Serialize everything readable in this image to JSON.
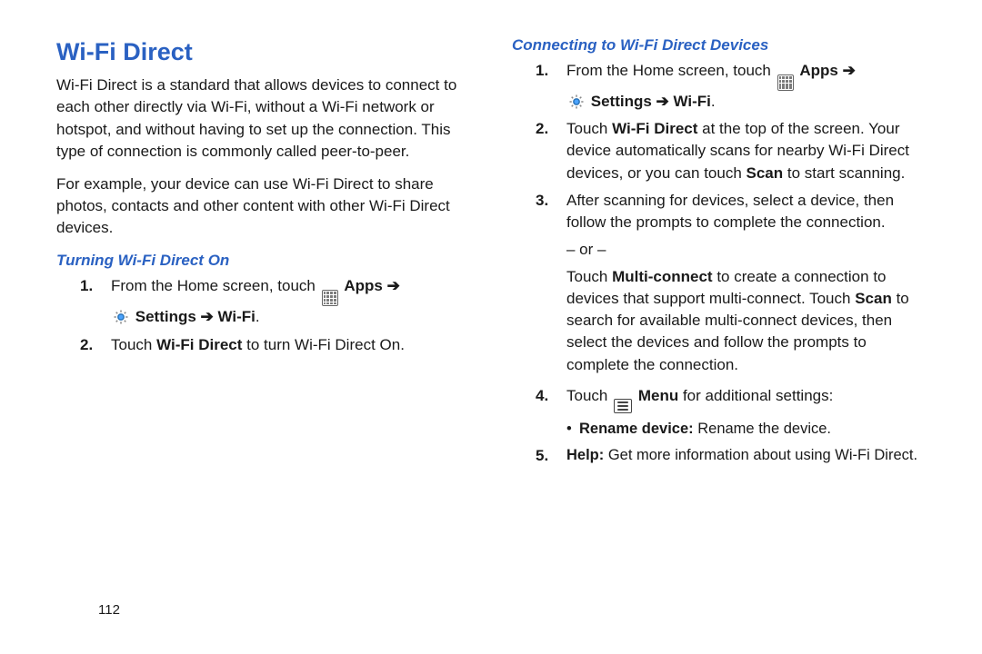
{
  "pageNumber": "112",
  "title": "Wi-Fi Direct",
  "intro1": "Wi-Fi Direct is a standard that allows devices to connect to each other directly via Wi-Fi, without a Wi-Fi network or hotspot, and without having to set up the connection. This type of connection is commonly called peer-to-peer.",
  "intro2": "For example, your device can use Wi-Fi Direct to share photos, contacts and other content with other Wi-Fi Direct devices.",
  "sub1": "Turning Wi-Fi Direct On",
  "left_step1_a": "From the Home screen, touch ",
  "apps_label": "Apps",
  "arrow": "➔",
  "settings_label": "Settings",
  "wifi_label": "Wi-Fi",
  "period": ".",
  "left_step2_a": "Touch ",
  "left_step2_b": "Wi-Fi Direct",
  "left_step2_c": " to turn Wi-Fi Direct On.",
  "sub2": "Connecting to Wi-Fi Direct Devices",
  "r_step1_a": "From the Home screen, touch ",
  "r_step2_a": "Touch ",
  "r_step2_b": "Wi-Fi Direct",
  "r_step2_c": " at the top of the screen. Your device automatically scans for nearby Wi-Fi Direct devices, or you can touch ",
  "r_step2_d": "Scan",
  "r_step2_e": " to start scanning.",
  "r_step3": "After scanning for devices, select a device, then follow the prompts to complete the connection.",
  "or_text": "– or –",
  "r_mc_a": "Touch ",
  "r_mc_b": "Multi-connect",
  "r_mc_c": " to create a connection to devices that support multi-connect. Touch ",
  "r_mc_d": "Scan",
  "r_mc_e": " to search for available multi-connect devices, then select the devices and follow the prompts to complete the connection.",
  "r_step4_a": "Touch ",
  "menu_label": "Menu",
  "r_step4_c": " for additional settings:",
  "bullet1_a": "Rename device:",
  "bullet1_b": " Rename the device.",
  "r_step5_a": "Help:",
  "r_step5_b": " Get more information about using Wi-Fi Direct.",
  "nums": {
    "n1": "1.",
    "n2": "2.",
    "n3": "3.",
    "n4": "4.",
    "n5": "5."
  }
}
